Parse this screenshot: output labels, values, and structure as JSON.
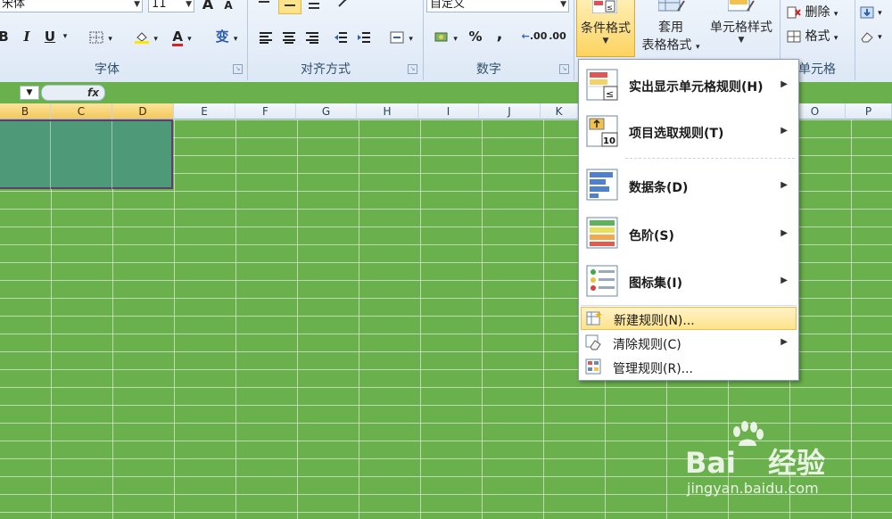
{
  "ribbon": {
    "font_group": {
      "font_name": "宋体",
      "font_size": "11",
      "grow_label": "A",
      "shrink_label": "A",
      "bold": "B",
      "italic": "I",
      "underline": "U",
      "phonetic": "变",
      "label": "字体"
    },
    "alignment_group": {
      "label": "对齐方式"
    },
    "number_group": {
      "format_value": "自定义",
      "percent": "%",
      "comma": ",",
      "inc_decimal": ".00",
      "dec_decimal": ".00",
      "label": "数字"
    },
    "styles_group": {
      "conditional_format": "条件格式",
      "table_format_line1": "套用",
      "table_format_line2": "表格格式",
      "cell_styles": "单元格样式"
    },
    "cells_group": {
      "delete": "删除",
      "format": "格式",
      "label": "单元格"
    }
  },
  "formula_bar": {
    "fx": "fx"
  },
  "columns": [
    "B",
    "C",
    "D",
    "E",
    "F",
    "G",
    "H",
    "I",
    "J",
    "K",
    "O",
    "P"
  ],
  "menu": {
    "items": [
      {
        "label": "实出显示单元格规则(H)",
        "icon": "highlight-cells-rules-icon",
        "submenu": true
      },
      {
        "label": "项目选取规则(T)",
        "icon": "top-bottom-rules-icon",
        "submenu": true
      },
      {
        "label": "数据条(D)",
        "icon": "data-bars-icon",
        "submenu": true
      },
      {
        "label": "色阶(S)",
        "icon": "color-scales-icon",
        "submenu": true
      },
      {
        "label": "图标集(I)",
        "icon": "icon-sets-icon",
        "submenu": true
      },
      {
        "label": "新建规则(N)...",
        "icon": "new-rule-icon",
        "submenu": false
      },
      {
        "label": "清除规则(C)",
        "icon": "clear-rules-icon",
        "submenu": true
      },
      {
        "label": "管理规则(R)...",
        "icon": "manage-rules-icon",
        "submenu": false
      }
    ]
  },
  "watermark": {
    "brand": "Bai",
    "brand2": "经验",
    "url": "jingyan.baidu.com"
  },
  "colors": {
    "sheet_green": "#6ab04c",
    "selection": "#4e9a78",
    "highlight": "#fde38a"
  }
}
